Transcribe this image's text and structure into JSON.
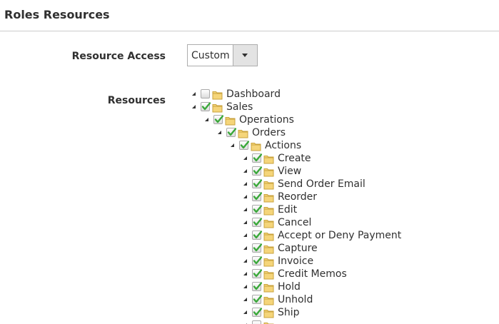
{
  "section": {
    "title": "Roles Resources"
  },
  "resource_access": {
    "label": "Resource Access",
    "selected": "Custom"
  },
  "resources": {
    "label": "Resources",
    "tree": [
      {
        "label": "Dashboard",
        "depth": 0,
        "checked": false
      },
      {
        "label": "Sales",
        "depth": 0,
        "checked": true
      },
      {
        "label": "Operations",
        "depth": 1,
        "checked": true
      },
      {
        "label": "Orders",
        "depth": 2,
        "checked": true
      },
      {
        "label": "Actions",
        "depth": 3,
        "checked": true
      },
      {
        "label": "Create",
        "depth": 4,
        "checked": true
      },
      {
        "label": "View",
        "depth": 4,
        "checked": true
      },
      {
        "label": "Send Order Email",
        "depth": 4,
        "checked": true
      },
      {
        "label": "Reorder",
        "depth": 4,
        "checked": true
      },
      {
        "label": "Edit",
        "depth": 4,
        "checked": true
      },
      {
        "label": "Cancel",
        "depth": 4,
        "checked": true
      },
      {
        "label": "Accept or Deny Payment",
        "depth": 4,
        "checked": true
      },
      {
        "label": "Capture",
        "depth": 4,
        "checked": true
      },
      {
        "label": "Invoice",
        "depth": 4,
        "checked": true
      },
      {
        "label": "Credit Memos",
        "depth": 4,
        "checked": true
      },
      {
        "label": "Hold",
        "depth": 4,
        "checked": true
      },
      {
        "label": "Unhold",
        "depth": 4,
        "checked": true
      },
      {
        "label": "Ship",
        "depth": 4,
        "checked": true
      },
      {
        "label": "",
        "depth": 4,
        "checked": false
      }
    ]
  },
  "colors": {
    "check": "#3aa83a",
    "folder_fill": "#f5d57a",
    "folder_stroke": "#c9a23c"
  }
}
